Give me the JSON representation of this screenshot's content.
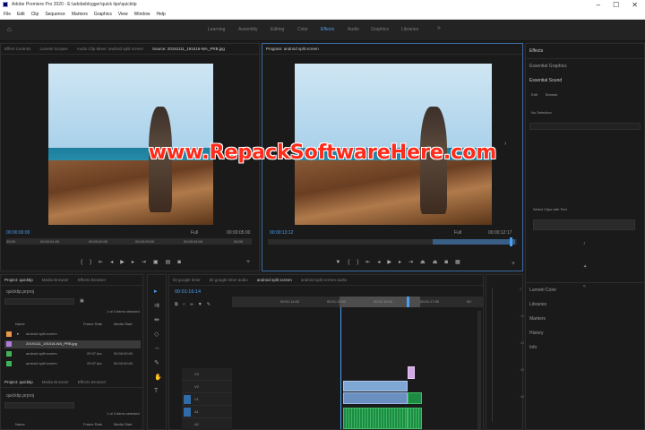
{
  "window": {
    "title": "Adobe Premiere Pro 2020 - E:\\adobeblogger\\quick tips\\quicktip",
    "controls": [
      "–",
      "☐",
      "✕"
    ]
  },
  "menu": [
    "File",
    "Edit",
    "Clip",
    "Sequence",
    "Markers",
    "Graphics",
    "View",
    "Window",
    "Help"
  ],
  "workspaces": [
    "Learning",
    "Assembly",
    "Editing",
    "Color",
    "Effects",
    "Audio",
    "Graphics",
    "Libraries"
  ],
  "source_panel": {
    "tabs": [
      "Effect Controls",
      "Lumetri Scopes",
      "Audio Clip Mixer: android split screen",
      "Source: 20191111_191516-WA_PRB.jpg"
    ],
    "timecode_left": "00:00:00:00",
    "timecode_right": "00:00:05:00",
    "fit": "Full",
    "ruler": [
      "00:00",
      "00:00:01:00",
      "00:00:02:00",
      "00:00:03:00",
      "00:00:04:00",
      "00:00"
    ]
  },
  "program_panel": {
    "tab": "Program: android split screen",
    "timecode_left": "00:00:13:12",
    "timecode_right": "00:00:12:17",
    "fit": "Full"
  },
  "right_panel": {
    "title": "Effects",
    "items": [
      "Essential Graphics",
      "Essential Sound",
      "Edit",
      "Browse",
      "No Selection",
      "Select Clips with Text",
      "Lumetri Color",
      "Libraries",
      "Markers",
      "History",
      "Info"
    ]
  },
  "project_panel": {
    "tabs": [
      "Project: quicktip",
      "Media Browser",
      "Effects Browser"
    ],
    "filename": "quicktip.prproj",
    "count": "1 of 4 items selected",
    "columns": [
      "Name",
      "Frame Rate",
      "Media Start"
    ],
    "items": [
      {
        "name": "android split screen",
        "rate": "",
        "start": "",
        "color": "#e9974a"
      },
      {
        "name": "20191111_191516-WA_PRB.jpg",
        "rate": "",
        "start": "",
        "color": "#b07bd8"
      },
      {
        "name": "android split screen",
        "rate": "29.97 fps",
        "start": "00:00:00:00",
        "color": "#3fb25a"
      },
      {
        "name": "android split screen",
        "rate": "29.97 fps",
        "start": "00:00:00:00",
        "color": "#3fb25a"
      }
    ],
    "second_tabs": [
      "Project: quicktip",
      "Media Browser",
      "Effects Browser"
    ],
    "second_filename": "quicktip.prproj",
    "second_count": "1 of 4 items selected"
  },
  "timeline": {
    "tabs": [
      "bit google timer",
      "bit google timer audio",
      "android split screen",
      "android split screen audio"
    ],
    "timecode": "00:01:16:14",
    "ruler": [
      "00:01:14:02",
      "00:01:15:02",
      "00:01:16:02",
      "00:01:17:00",
      "00:"
    ],
    "tracks": [
      "V3",
      "V2",
      "V1",
      "A1",
      "A2",
      "A3"
    ]
  },
  "watermark": "www.RepackSoftwareHere.com",
  "colors": {
    "accent_blue": "#4b9ff0",
    "video_clip": "#7fa7d6",
    "audio_clip": "#1f8a43",
    "watermark": "#ff2a1a"
  }
}
